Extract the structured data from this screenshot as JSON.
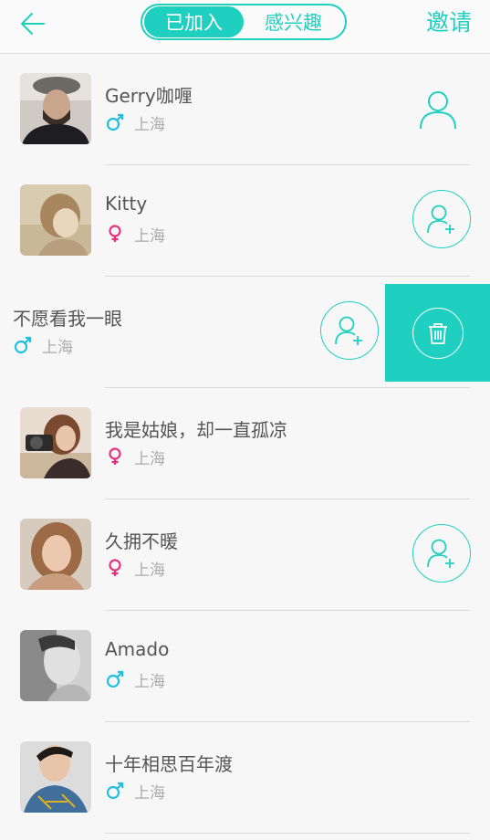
{
  "header": {
    "tabs": [
      {
        "label": "已加入",
        "active": true
      },
      {
        "label": "感兴趣",
        "active": false
      }
    ],
    "invite_label": "邀请"
  },
  "colors": {
    "accent": "#1fd0c1",
    "male": "#1fc0e0",
    "female": "#e8307a"
  },
  "members": [
    {
      "name": "Gerry咖喱",
      "gender": "male",
      "city": "上海",
      "action": "profile-icon"
    },
    {
      "name": "Kitty",
      "gender": "female",
      "city": "上海",
      "action": "add-friend-icon"
    },
    {
      "name": "不愿看我一眼",
      "gender": "male",
      "city": "上海",
      "action": "add-friend-icon",
      "swiped": true,
      "delete_icon": "trash-icon"
    },
    {
      "name": "我是姑娘，却一直孤凉",
      "gender": "female",
      "city": "上海",
      "action": ""
    },
    {
      "name": "久拥不暖",
      "gender": "female",
      "city": "上海",
      "action": "add-friend-icon"
    },
    {
      "name": "Amado",
      "gender": "male",
      "city": "上海",
      "action": ""
    },
    {
      "name": "十年相思百年渡",
      "gender": "male",
      "city": "上海",
      "action": ""
    }
  ]
}
